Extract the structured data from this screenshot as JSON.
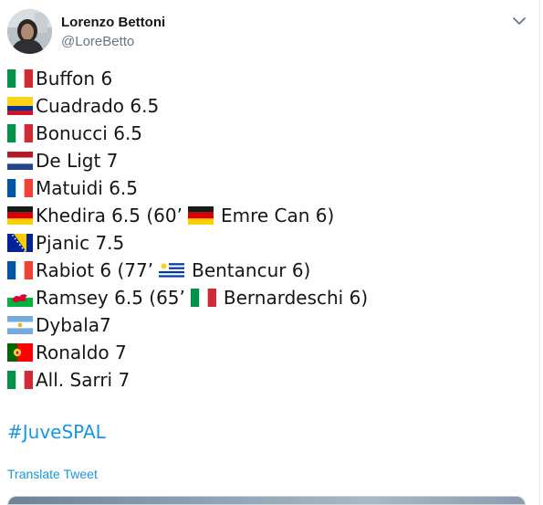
{
  "tweet": {
    "author_name": "Lorenzo Bettoni",
    "author_handle": "@LoreBetto",
    "hashtag": "#JuveSPAL",
    "translate_label": "Translate Tweet",
    "lines": [
      {
        "flag": "italy-flag-icon",
        "text": "Buffon 6"
      },
      {
        "flag": "colombia-flag-icon",
        "text": "Cuadrado 6.5"
      },
      {
        "flag": "italy-flag-icon",
        "text": "Bonucci 6.5"
      },
      {
        "flag": "netherlands-flag-icon",
        "text": "De Ligt 7"
      },
      {
        "flag": "france-flag-icon",
        "text": "Matuidi 6.5"
      },
      {
        "flag": "germany-flag-icon",
        "text": "Khedira 6.5 (60’",
        "sub_flag": "germany-flag-icon",
        "sub_text": "Emre Can 6)"
      },
      {
        "flag": "bosnia-flag-icon",
        "text": "Pjanic 7.5"
      },
      {
        "flag": "france-flag-icon",
        "text": "Rabiot 6 (77’",
        "sub_flag": "uruguay-flag-icon",
        "sub_text": "Bentancur 6)"
      },
      {
        "flag": "wales-flag-icon",
        "text": "Ramsey 6.5 (65’",
        "sub_flag": "italy-flag-icon",
        "sub_text": "Bernardeschi 6)"
      },
      {
        "flag": "argentina-flag-icon",
        "text": "Dybala7"
      },
      {
        "flag": "portugal-flag-icon",
        "text": "Ronaldo 7"
      },
      {
        "flag": "italy-flag-icon",
        "text": "All. Sarri 7"
      }
    ]
  },
  "icons": {
    "avatar": "avatar",
    "menu": "chevron-down-icon"
  },
  "colors": {
    "link": "#1b95e0",
    "secondary_text": "#657786",
    "primary_text": "#14171a"
  }
}
